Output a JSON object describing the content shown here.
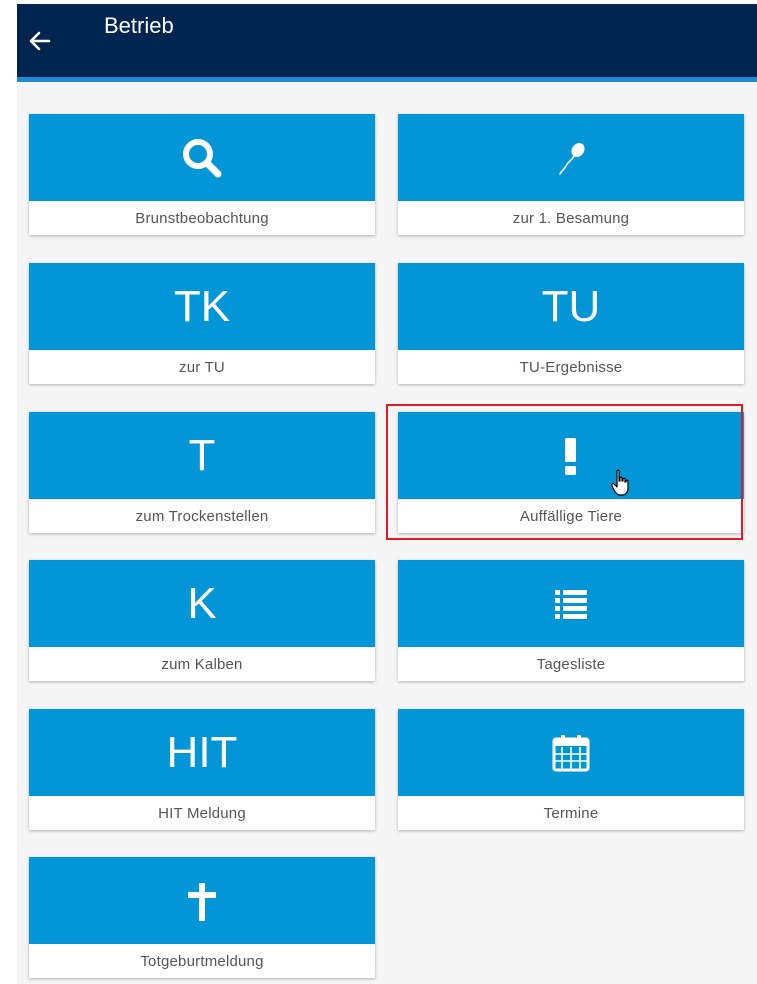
{
  "header": {
    "title": "Betrieb",
    "back_icon": "arrow-left-icon"
  },
  "colors": {
    "header_bg": "#00264f",
    "accent": "#1e88d2",
    "tile_bg": "#0396d6",
    "highlight": "#e01b24"
  },
  "tiles": [
    {
      "label": "Brunstbeobachtung",
      "icon": "search-icon"
    },
    {
      "label": "zur 1. Besamung",
      "icon": "sperm-icon"
    },
    {
      "label": "zur TU",
      "icon_text": "TK"
    },
    {
      "label": "TU-Ergebnisse",
      "icon_text": "TU"
    },
    {
      "label": "zum Trockenstellen",
      "icon_text": "T"
    },
    {
      "label": "Auffällige Tiere",
      "icon": "exclamation-icon"
    },
    {
      "label": "zum Kalben",
      "icon_text": "K"
    },
    {
      "label": "Tagesliste",
      "icon": "list-icon"
    },
    {
      "label": "HIT Meldung",
      "icon_text": "HIT"
    },
    {
      "label": "Termine",
      "icon": "calendar-icon"
    },
    {
      "label": "Totgeburtmeldung",
      "icon": "cross-icon"
    }
  ]
}
